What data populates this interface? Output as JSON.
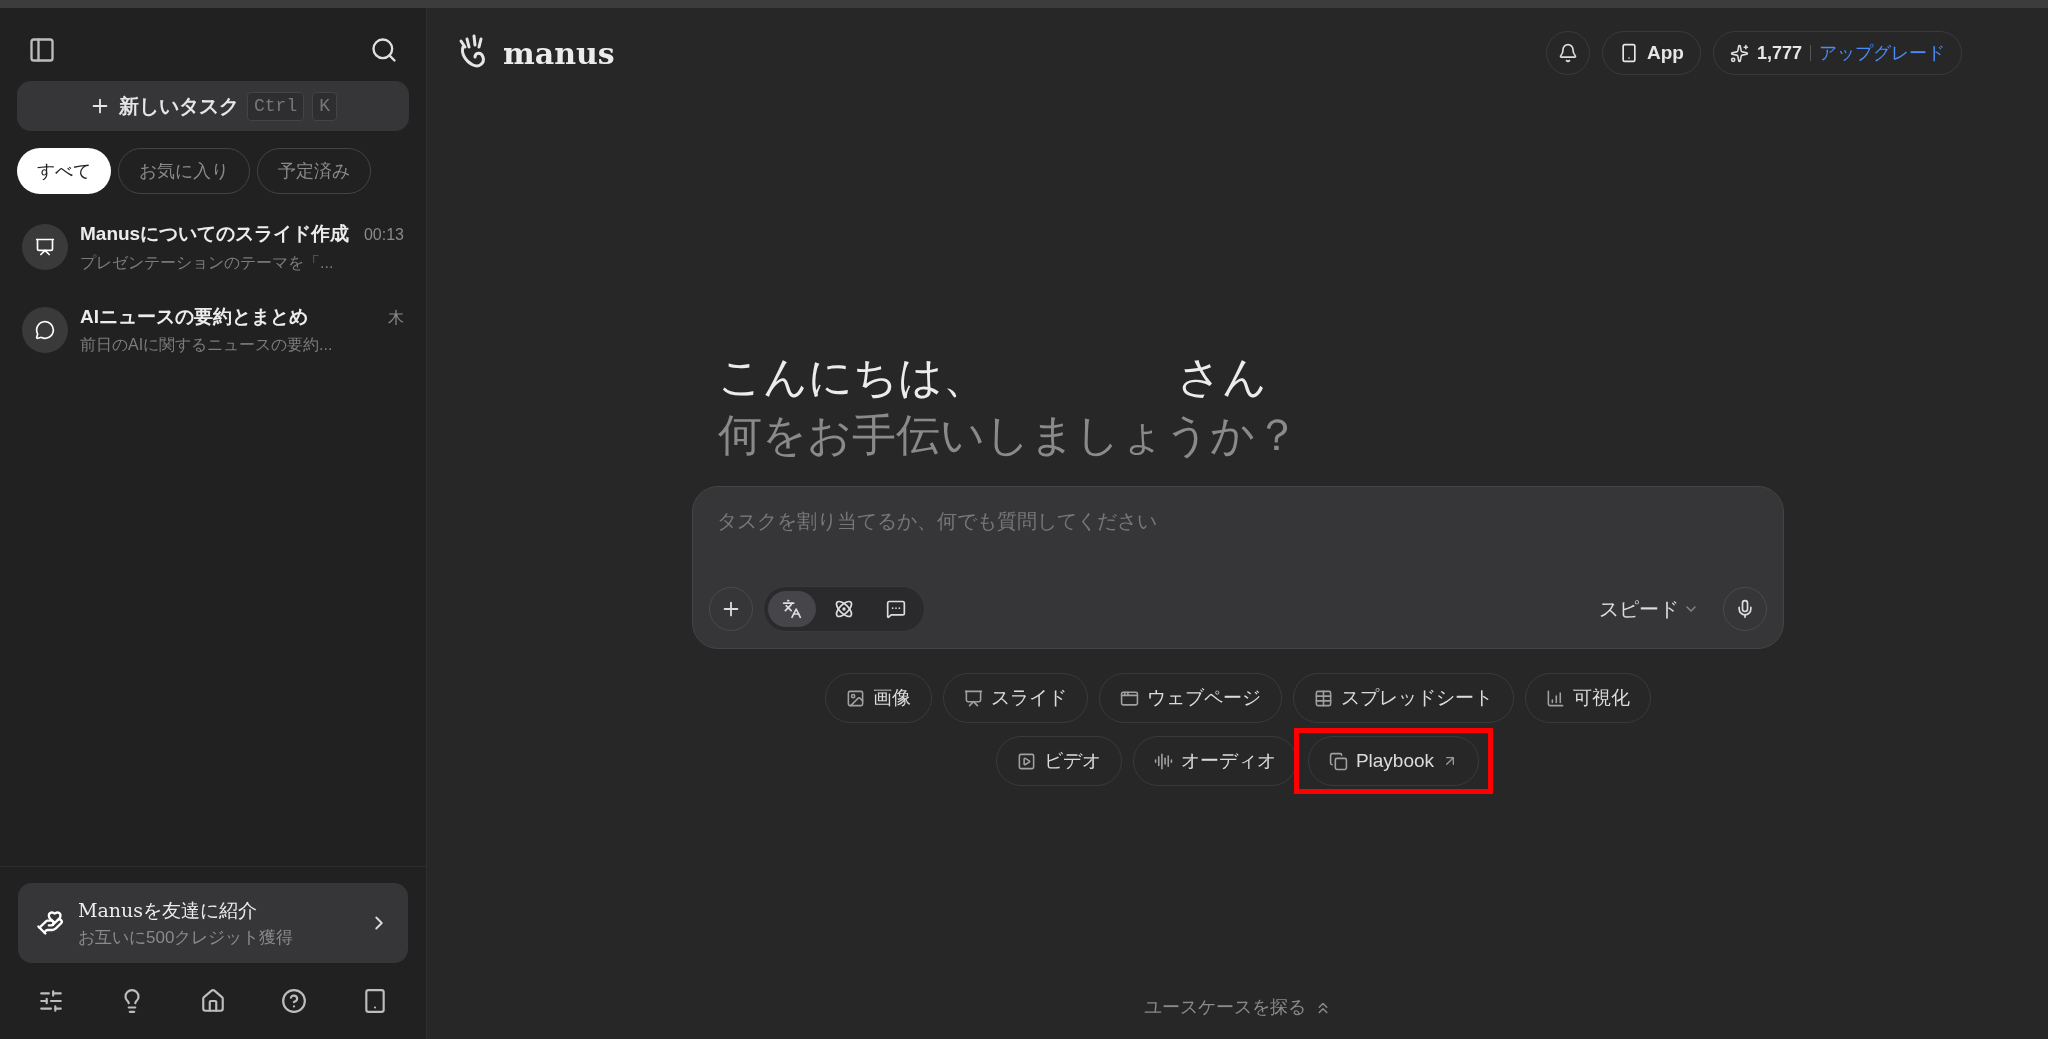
{
  "sidebar": {
    "new_task": {
      "label": "新しいタスク",
      "keys": [
        "Ctrl",
        "K"
      ]
    },
    "filters": [
      {
        "label": "すべて",
        "selected": true
      },
      {
        "label": "お気に入り",
        "selected": false
      },
      {
        "label": "予定済み",
        "selected": false
      }
    ],
    "tasks": [
      {
        "kind": "slides",
        "title": "Manusについてのスライド作成",
        "time": "00:13",
        "preview": "プレゼンテーションのテーマを「..."
      },
      {
        "kind": "chat",
        "title": "AIニュースの要約とまとめ",
        "time": "木",
        "preview": "前日のAIに関するニュースの要約..."
      }
    ],
    "referral": {
      "title": "Manusを友達に紹介",
      "subtitle": "お互いに500クレジット獲得"
    }
  },
  "header": {
    "logo": "manus",
    "app_button": "App",
    "credits": "1,777",
    "upgrade": "アップグレード"
  },
  "greeting": {
    "hello": "こんにちは、",
    "suffix": "さん",
    "question": "何をお手伝いしましょうか？"
  },
  "composer": {
    "placeholder": "タスクを割り当てるか、何でも質問してください",
    "modes": [
      {
        "kind": "agent",
        "selected": true
      },
      {
        "kind": "atom",
        "selected": false
      },
      {
        "kind": "chat",
        "selected": false
      }
    ],
    "speed": "スピード"
  },
  "chips": [
    {
      "kind": "image",
      "label": "画像",
      "highlighted": false
    },
    {
      "kind": "slides",
      "label": "スライド",
      "highlighted": false
    },
    {
      "kind": "webpage",
      "label": "ウェブページ",
      "highlighted": false
    },
    {
      "kind": "spreadsheet",
      "label": "スプレッドシート",
      "highlighted": false
    },
    {
      "kind": "chart",
      "label": "可視化",
      "highlighted": false
    },
    {
      "kind": "video",
      "label": "ビデオ",
      "highlighted": false
    },
    {
      "kind": "audio",
      "label": "オーディオ",
      "highlighted": false
    },
    {
      "kind": "playbook",
      "label": "Playbook",
      "highlighted": true
    }
  ],
  "footer": {
    "explore": "ユースケースを探る"
  }
}
